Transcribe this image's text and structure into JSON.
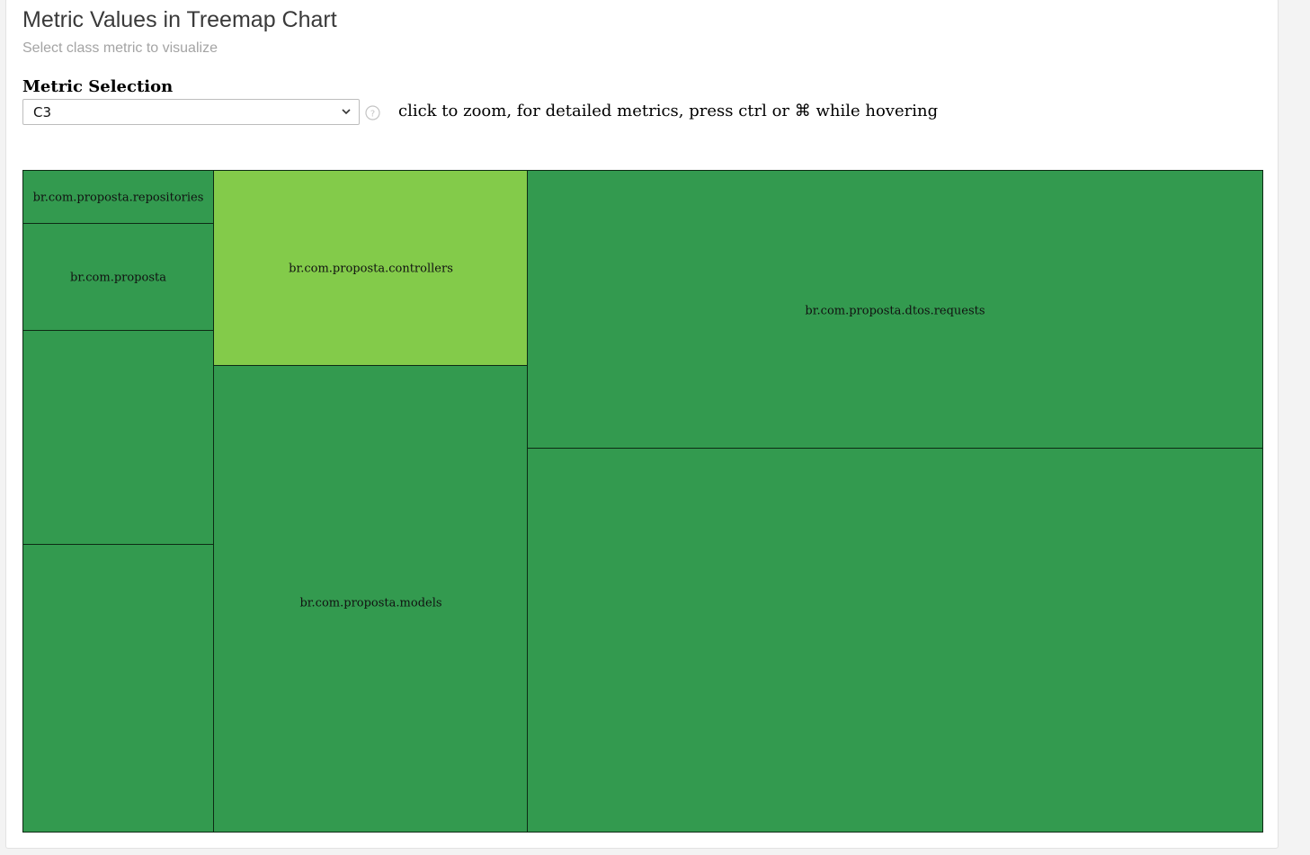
{
  "header": {
    "title": "Metric Values in Treemap Chart",
    "subtitle": "Select class metric to visualize"
  },
  "metric_selection": {
    "label": "Metric Selection",
    "selected_value": "C3",
    "help_icon": "question-circle-icon",
    "hint": "click to zoom, for detailed metrics, press ctrl or ⌘ while hovering"
  },
  "treemap": {
    "colors": {
      "dark_green": "#339a4f",
      "light_green": "#83cb4a",
      "border": "#0d2a14"
    },
    "cells": [
      {
        "label": "br.com.proposta.repositories",
        "color": "#339a4f"
      },
      {
        "label": "br.com.proposta",
        "color": "#339a4f"
      },
      {
        "label": "",
        "color": "#339a4f"
      },
      {
        "label": "",
        "color": "#339a4f"
      },
      {
        "label": "br.com.proposta.controllers",
        "color": "#83cb4a"
      },
      {
        "label": "br.com.proposta.models",
        "color": "#339a4f"
      },
      {
        "label": "br.com.proposta.dtos.requests",
        "color": "#339a4f"
      },
      {
        "label": "",
        "color": "#339a4f"
      }
    ]
  }
}
